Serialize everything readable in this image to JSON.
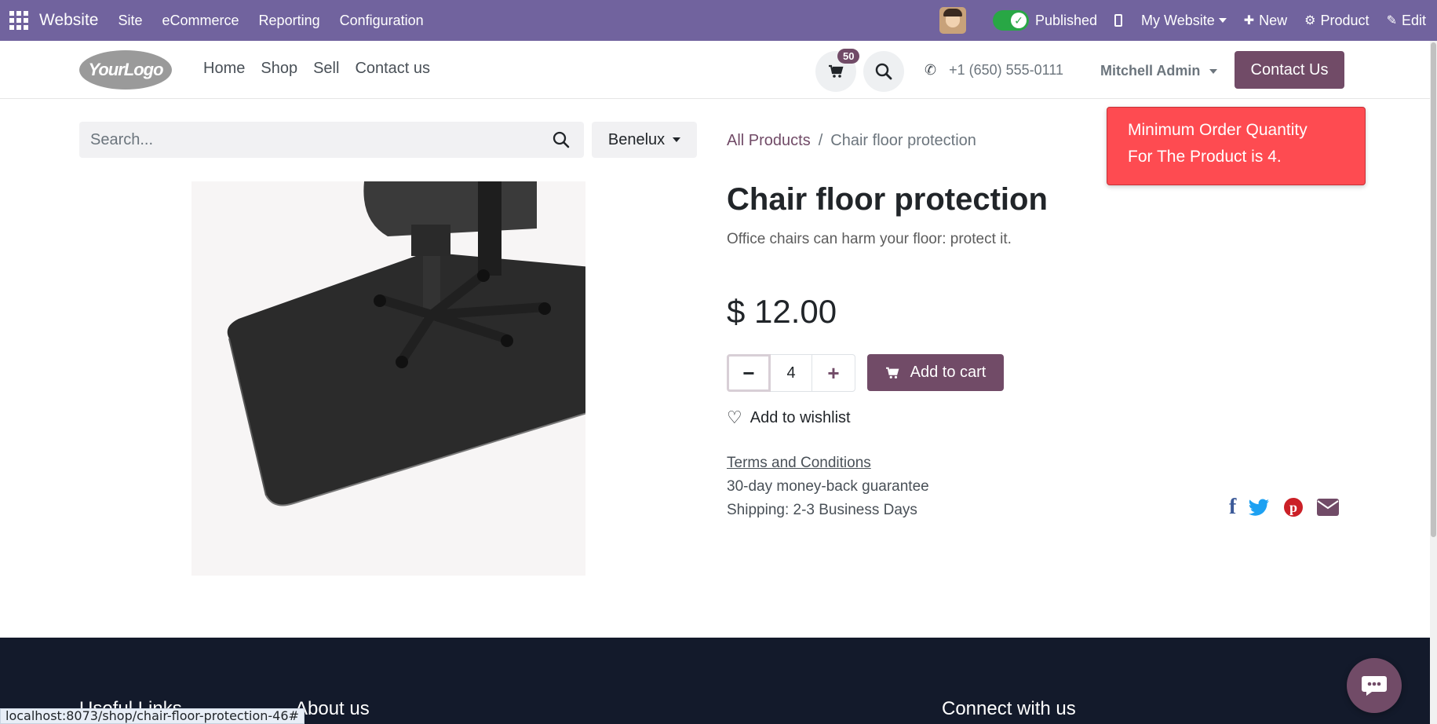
{
  "admin_bar": {
    "app_name": "Website",
    "menus": [
      "Site",
      "eCommerce",
      "Reporting",
      "Configuration"
    ],
    "published_label": "Published",
    "website_label": "My Website",
    "new_label": "New",
    "product_label": "Product",
    "edit_label": "Edit"
  },
  "header": {
    "logo_text": "YourLogo",
    "nav": [
      "Home",
      "Shop",
      "Sell",
      "Contact us"
    ],
    "cart_count": "50",
    "phone": "+1 (650) 555-0111",
    "user": "Mitchell Admin",
    "contact_button": "Contact Us"
  },
  "search": {
    "placeholder": "Search...",
    "pricelist": "Benelux"
  },
  "breadcrumb": {
    "all_products": "All Products",
    "separator": "/",
    "current": "Chair floor protection"
  },
  "notification": {
    "line1": "Minimum Order Quantity",
    "line2": "For The Product is 4."
  },
  "product": {
    "name": "Chair floor protection",
    "description": "Office chairs can harm your floor: protect it.",
    "price": "$ 12.00",
    "quantity": "4",
    "add_to_cart": "Add to cart",
    "wishlist": "Add to wishlist",
    "terms": "Terms and Conditions",
    "guarantee": "30-day money-back guarantee",
    "shipping": "Shipping: 2-3 Business Days"
  },
  "share_icons": [
    "facebook-icon",
    "twitter-icon",
    "pinterest-icon",
    "email-icon"
  ],
  "footer": {
    "col1": "Useful Links",
    "col2": "About us",
    "col3": "Connect with us"
  },
  "status_url": "localhost:8073/shop/chair-floor-protection-46#",
  "colors": {
    "admin_bar": "#71639e",
    "primary": "#714b67",
    "notification": "#fe4b51",
    "footer": "#131a2b"
  }
}
